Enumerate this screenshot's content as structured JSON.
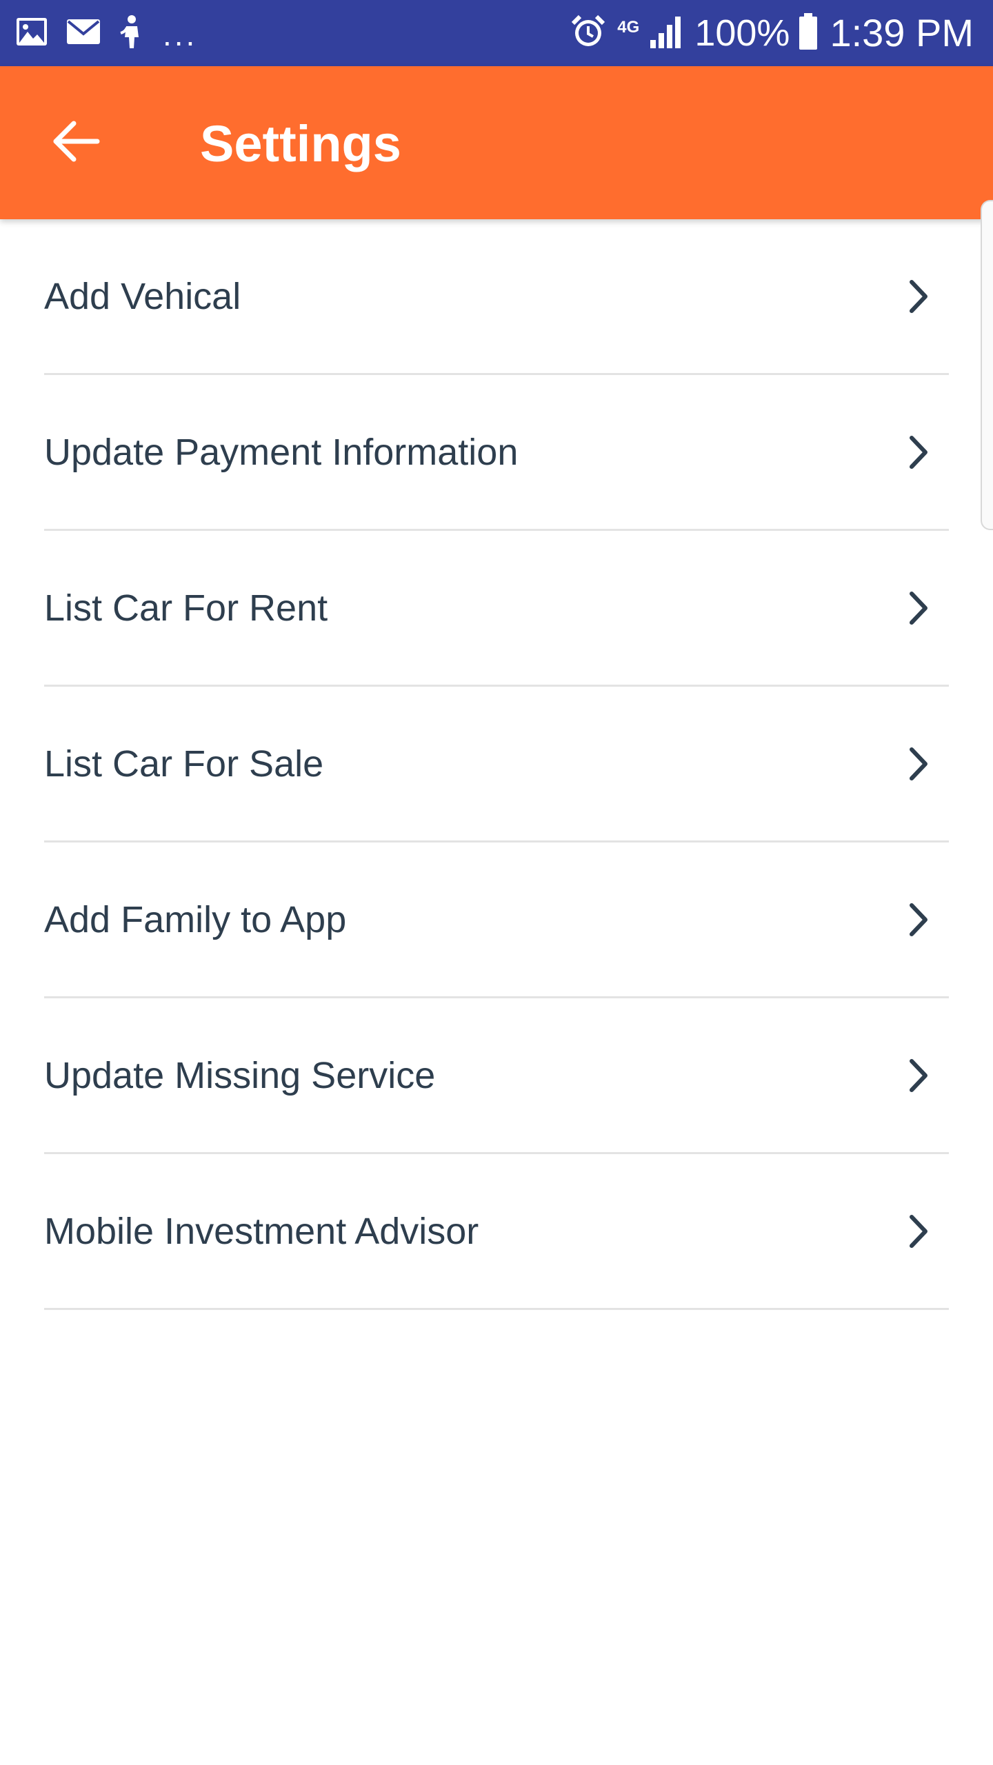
{
  "status_bar": {
    "left_icons": [
      "image-icon",
      "mail-icon",
      "person-icon"
    ],
    "more_dots": "...",
    "right_icons": [
      "alarm-icon",
      "signal-icon",
      "battery-icon"
    ],
    "network_type": "4G",
    "battery_percent": "100%",
    "time": "1:39 PM",
    "background": "#33409d"
  },
  "app_bar": {
    "title": "Settings",
    "back_icon": "arrow-left-icon",
    "background": "#ff6d2e"
  },
  "settings": {
    "items": [
      {
        "label": "Add Vehical"
      },
      {
        "label": "Update Payment Information"
      },
      {
        "label": "List Car For Rent"
      },
      {
        "label": "List Car For Sale"
      },
      {
        "label": "Add Family to App"
      },
      {
        "label": "Update Missing Service"
      },
      {
        "label": "Mobile Investment Advisor"
      }
    ],
    "chevron_icon": "chevron-right-icon",
    "text_color": "#2e3e4e"
  }
}
